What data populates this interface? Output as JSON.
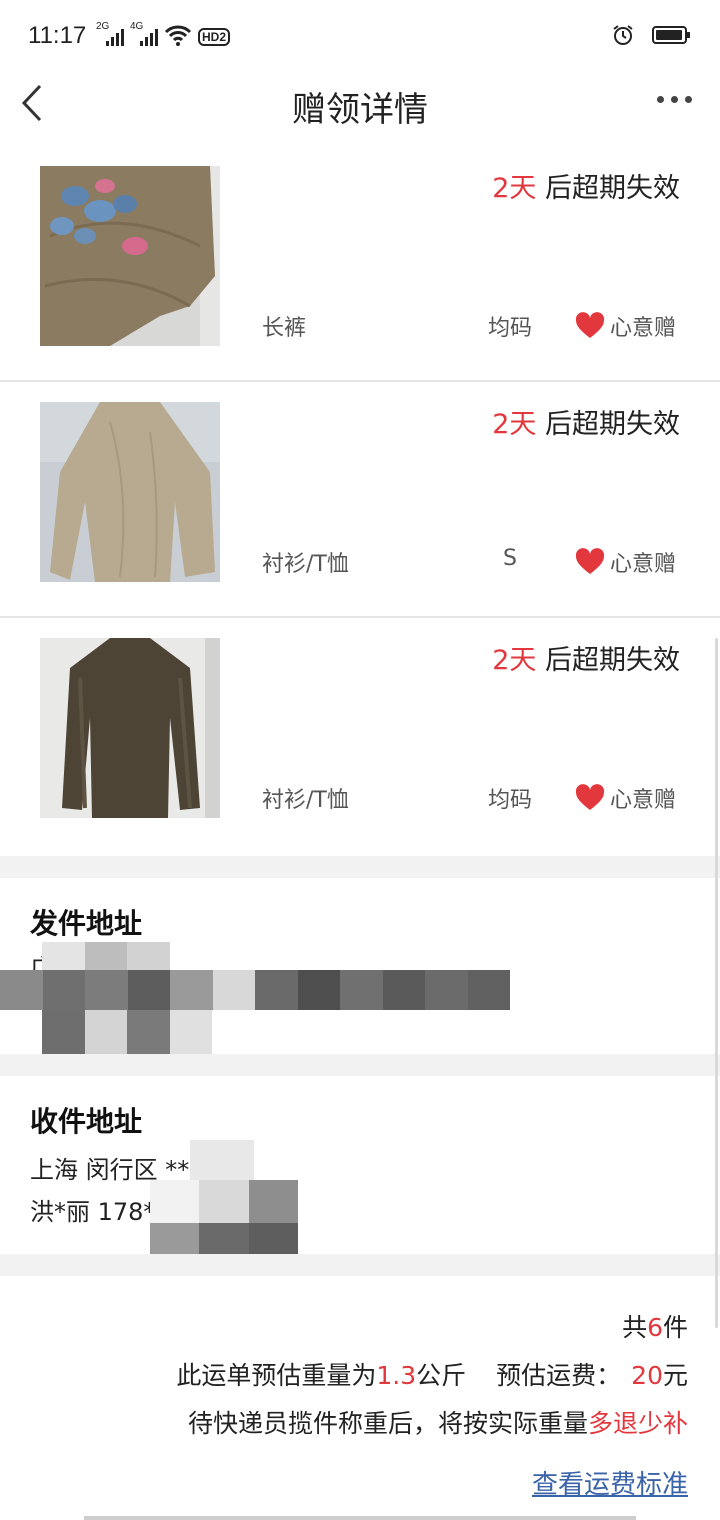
{
  "status_bar": {
    "time": "11:17",
    "sig1": "2G",
    "sig2": "4G",
    "hd": "HD2"
  },
  "header": {
    "title": "赠领详情"
  },
  "items": [
    {
      "expiry_days": "2天",
      "expiry_suffix": " 后超期失效",
      "category": "长裤",
      "size": "均码",
      "gift_label": "心意赠"
    },
    {
      "expiry_days": "2天",
      "expiry_suffix": " 后超期失效",
      "category": "衬衫/T恤",
      "size": "S",
      "gift_label": "心意赠"
    },
    {
      "expiry_days": "2天",
      "expiry_suffix": " 后超期失效",
      "category": "衬衫/T恤",
      "size": "均码",
      "gift_label": "心意赠"
    }
  ],
  "sender": {
    "title": "发件地址",
    "line1": "广"
  },
  "receiver": {
    "title": "收件地址",
    "line1": "上海 闵行区 *******",
    "line2": "洪*丽 178********"
  },
  "summary": {
    "count_prefix": "共",
    "count": "6",
    "count_suffix": "件",
    "weight_prefix": "此运单预估重量为",
    "weight": "1.3",
    "weight_unit": "公斤",
    "fee_label": "预估运费：",
    "fee": "20",
    "fee_unit": "元",
    "note_prefix": "待快递员揽件称重后，将按实际重量",
    "note_highlight": "多退少补",
    "link": "查看运费标准"
  },
  "colors": {
    "accent_red": "#e2373c",
    "link_blue": "#3a63a8"
  }
}
